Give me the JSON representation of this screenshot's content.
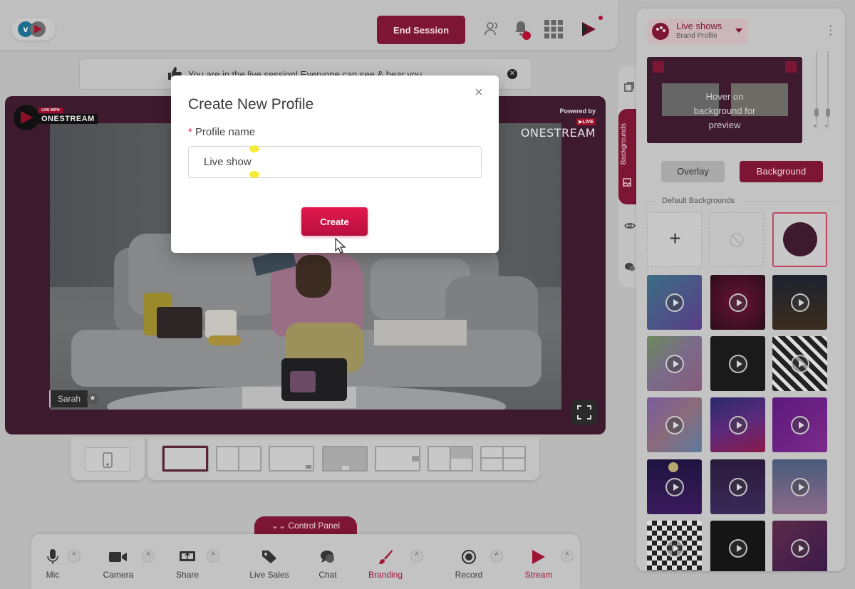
{
  "header": {
    "end_session_label": "End Session",
    "notice_text": "You are in the live session! Everyone can see & hear you"
  },
  "stage": {
    "badge_small": "LIVE WITH",
    "badge_brand": "ONESTREAM",
    "powered_by": "Powered by",
    "live_tag": "▶LIVE",
    "watermark": "ONESTREAM",
    "participant_name": "Sarah"
  },
  "control_panel": {
    "tab_label": "Control Panel",
    "tools": [
      {
        "label": "Mic",
        "icon": "mic-icon"
      },
      {
        "label": "Camera",
        "icon": "camera-icon"
      },
      {
        "label": "Share",
        "icon": "share-screen-icon"
      },
      {
        "label": "Live Sales",
        "icon": "tag-icon"
      },
      {
        "label": "Chat",
        "icon": "chat-icon"
      },
      {
        "label": "Branding",
        "icon": "brush-icon"
      },
      {
        "label": "Record",
        "icon": "record-icon"
      },
      {
        "label": "Stream",
        "icon": "play-icon"
      }
    ]
  },
  "right_panel": {
    "profile_name": "Live shows",
    "profile_type": "Brand Profile",
    "vertical_tab": "Backgrounds",
    "preview_hint": "Hover on background for preview",
    "segment_overlay": "Overlay",
    "segment_background": "Background",
    "section_title": "Default Backgrounds"
  },
  "modal": {
    "title": "Create New Profile",
    "field_label": "Profile name",
    "required_mark": "*",
    "field_value": "Live show",
    "create_label": "Create",
    "close_label": "×"
  },
  "colors": {
    "accent": "#b80f3d",
    "brand_dark": "#3e1a2e",
    "required": "#d7325c"
  }
}
